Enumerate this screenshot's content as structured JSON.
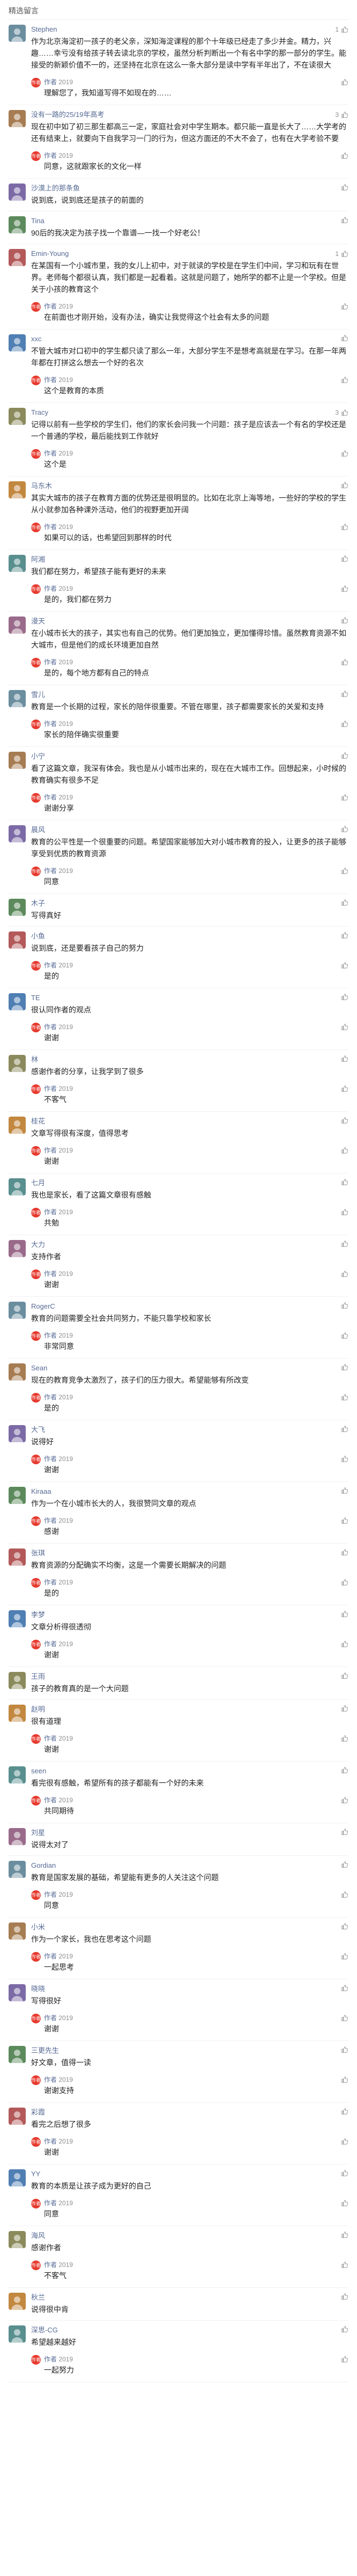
{
  "section_title": "精选留言",
  "author_name": "作者",
  "comments": [
    {
      "nick": "Stephen",
      "likes": "1",
      "text": "作为北京海淀初一孩子的老父亲，深知海淀课程的那个十年级已经走了多少并金。精力，兴趣……幸亏没有给孩子转去读北京的学校，虽然分析判断出一个有名中学的那一部分的学生。能接受的新颖价值不一的，还坚持在北京在这么一条大部分是读中学有半年出了，不在读很大",
      "reply_date": "2019",
      "reply_likes": "",
      "reply_text": "理解您了，我知道写得不如现在的……"
    },
    {
      "nick": "没有一路的25/19年高考",
      "likes": "3",
      "text": "现在初中如了初三那生都高三一定，家庭社会对中学生期本。都只能一直是长大了……大学考的还有结束上，就要向下自我学习一门的行为，但这方面还的不大不会了，也有在大学考验不要",
      "reply_date": "2019",
      "reply_likes": "",
      "reply_text": "同意，这就跟家长的文化一样"
    },
    {
      "nick": "沙漠上的那条鱼",
      "likes": "",
      "text": "说到底，说到底还是孩子的前面的",
      "reply_date": "",
      "reply_likes": "",
      "reply_text": ""
    },
    {
      "nick": "Tina",
      "likes": "",
      "text": "90后的我决定为孩子找一个靠谱—一找一个好老公！",
      "reply_date": "",
      "reply_likes": "",
      "reply_text": ""
    },
    {
      "nick": "Emin-Young",
      "likes": "1",
      "text": "在某国有一个小城市里，我的女儿上初中，对于就读的学校是在学生们中间，学习和玩有在世界。老师每个都很认真，我们都是一起看着。这就是问题了，她所学的都不止是一个学校。但是关于小孩的教育这个",
      "reply_date": "2019",
      "reply_likes": "",
      "reply_text": "在前面也才刚开始，没有办法，确实让我觉得这个社会有太多的问题"
    },
    {
      "nick": "xxc",
      "likes": "",
      "text": "不管大城市对口初中的学生都只读了那么一年，大部分学生不是想考高就是在学习。在那一年两年都在打拼这么想去一个好的名次",
      "reply_date": "2019",
      "reply_likes": "",
      "reply_text": "这个是教育的本质"
    },
    {
      "nick": "Tracy",
      "likes": "3",
      "text": "记得以前有一些学校的学生们，他们的家长会问我一个问题：孩子是应该去一个有名的学校还是一个普通的学校，最后能找到工作就好",
      "reply_date": "2019",
      "reply_likes": "",
      "reply_text": "这个是"
    },
    {
      "nick": "马东木",
      "likes": "",
      "text": "其实大城市的孩子在教育方面的优势还是很明显的。比如在北京上海等地，一些好的学校的学生从小就参加各种课外活动，他们的视野更加开阔",
      "reply_date": "2019",
      "reply_likes": "",
      "reply_text": "如果可以的话，也希望回到那样的时代"
    },
    {
      "nick": "阿湘",
      "likes": "",
      "text": "我们都在努力，希望孩子能有更好的未来",
      "reply_date": "2019",
      "reply_likes": "",
      "reply_text": "是的，我们都在努力"
    },
    {
      "nick": "漫天",
      "likes": "",
      "text": "在小城市长大的孩子，其实也有自己的优势。他们更加独立，更加懂得珍惜。虽然教育资源不如大城市，但是他们的成长环境更加自然",
      "reply_date": "2019",
      "reply_likes": "",
      "reply_text": "是的，每个地方都有自己的特点"
    },
    {
      "nick": "雪儿",
      "likes": "",
      "text": "教育是一个长期的过程，家长的陪伴很重要。不管在哪里，孩子都需要家长的关爱和支持",
      "reply_date": "2019",
      "reply_likes": "",
      "reply_text": "家长的陪伴确实很重要"
    },
    {
      "nick": "小宁",
      "likes": "",
      "text": "看了这篇文章，我深有体会。我也是从小城市出来的，现在在大城市工作。回想起来，小时候的教育确实有很多不足",
      "reply_date": "2019",
      "reply_likes": "",
      "reply_text": "谢谢分享"
    },
    {
      "nick": "晨风",
      "likes": "",
      "text": "教育的公平性是一个很重要的问题。希望国家能够加大对小城市教育的投入，让更多的孩子能够享受到优质的教育资源",
      "reply_date": "2019",
      "reply_likes": "",
      "reply_text": "同意"
    },
    {
      "nick": "木子",
      "likes": "",
      "text": "写得真好",
      "reply_date": "",
      "reply_likes": "",
      "reply_text": ""
    },
    {
      "nick": "小鱼",
      "likes": "",
      "text": "说到底，还是要看孩子自己的努力",
      "reply_date": "2019",
      "reply_likes": "",
      "reply_text": "是的"
    },
    {
      "nick": "TE",
      "likes": "",
      "text": "很认同作者的观点",
      "reply_date": "2019",
      "reply_likes": "",
      "reply_text": "谢谢"
    },
    {
      "nick": "林",
      "likes": "",
      "text": "感谢作者的分享，让我学到了很多",
      "reply_date": "2019",
      "reply_likes": "",
      "reply_text": "不客气"
    },
    {
      "nick": "桂花",
      "likes": "",
      "text": "文章写得很有深度，值得思考",
      "reply_date": "2019",
      "reply_likes": "",
      "reply_text": "谢谢"
    },
    {
      "nick": "七月",
      "likes": "",
      "text": "我也是家长，看了这篇文章很有感触",
      "reply_date": "2019",
      "reply_likes": "",
      "reply_text": "共勉"
    },
    {
      "nick": "大力",
      "likes": "",
      "text": "支持作者",
      "reply_date": "2019",
      "reply_likes": "",
      "reply_text": "谢谢"
    },
    {
      "nick": "RogerC",
      "likes": "",
      "text": "教育的问题需要全社会共同努力，不能只靠学校和家长",
      "reply_date": "2019",
      "reply_likes": "",
      "reply_text": "非常同意"
    },
    {
      "nick": "Sean",
      "likes": "",
      "text": "现在的教育竞争太激烈了，孩子们的压力很大。希望能够有所改变",
      "reply_date": "2019",
      "reply_likes": "",
      "reply_text": "是的"
    },
    {
      "nick": "大飞",
      "likes": "",
      "text": "说得好",
      "reply_date": "2019",
      "reply_likes": "",
      "reply_text": "谢谢"
    },
    {
      "nick": "Kiraaa",
      "likes": "",
      "text": "作为一个在小城市长大的人，我很赞同文章的观点",
      "reply_date": "2019",
      "reply_likes": "",
      "reply_text": "感谢"
    },
    {
      "nick": "张琪",
      "likes": "",
      "text": "教育资源的分配确实不均衡，这是一个需要长期解决的问题",
      "reply_date": "2019",
      "reply_likes": "",
      "reply_text": "是的"
    },
    {
      "nick": "李梦",
      "likes": "",
      "text": "文章分析得很透彻",
      "reply_date": "2019",
      "reply_likes": "",
      "reply_text": "谢谢"
    },
    {
      "nick": "王雨",
      "likes": "",
      "text": "孩子的教育真的是一个大问题",
      "reply_date": "",
      "reply_likes": "",
      "reply_text": ""
    },
    {
      "nick": "赵明",
      "likes": "",
      "text": "很有道理",
      "reply_date": "2019",
      "reply_likes": "",
      "reply_text": "谢谢"
    },
    {
      "nick": "seen",
      "likes": "",
      "text": "看完很有感触，希望所有的孩子都能有一个好的未来",
      "reply_date": "2019",
      "reply_likes": "",
      "reply_text": "共同期待"
    },
    {
      "nick": "刘星",
      "likes": "",
      "text": "说得太对了",
      "reply_date": "",
      "reply_likes": "",
      "reply_text": ""
    },
    {
      "nick": "Gordian",
      "likes": "",
      "text": "教育是国家发展的基础，希望能有更多的人关注这个问题",
      "reply_date": "2019",
      "reply_likes": "",
      "reply_text": "同意"
    },
    {
      "nick": "小米",
      "likes": "",
      "text": "作为一个家长，我也在思考这个问题",
      "reply_date": "2019",
      "reply_likes": "",
      "reply_text": "一起思考"
    },
    {
      "nick": "晓晓",
      "likes": "",
      "text": "写得很好",
      "reply_date": "2019",
      "reply_likes": "",
      "reply_text": "谢谢"
    },
    {
      "nick": "三更先生",
      "likes": "",
      "text": "好文章，值得一读",
      "reply_date": "2019",
      "reply_likes": "",
      "reply_text": "谢谢支持"
    },
    {
      "nick": "彩霞",
      "likes": "",
      "text": "看完之后想了很多",
      "reply_date": "2019",
      "reply_likes": "",
      "reply_text": "谢谢"
    },
    {
      "nick": "YY",
      "likes": "",
      "text": "教育的本质是让孩子成为更好的自己",
      "reply_date": "2019",
      "reply_likes": "",
      "reply_text": "同意"
    },
    {
      "nick": "海风",
      "likes": "",
      "text": "感谢作者",
      "reply_date": "2019",
      "reply_likes": "",
      "reply_text": "不客气"
    },
    {
      "nick": "秋兰",
      "likes": "",
      "text": "说得很中肯",
      "reply_date": "",
      "reply_likes": "",
      "reply_text": ""
    },
    {
      "nick": "深思-CG",
      "likes": "",
      "text": "希望越来越好",
      "reply_date": "2019",
      "reply_likes": "",
      "reply_text": "一起努力"
    }
  ],
  "colors": {
    "nick": "#576b95",
    "author_badge": "#e63a2e"
  },
  "icons": {
    "like": "thumb-up-icon",
    "author": "author-badge-icon"
  }
}
